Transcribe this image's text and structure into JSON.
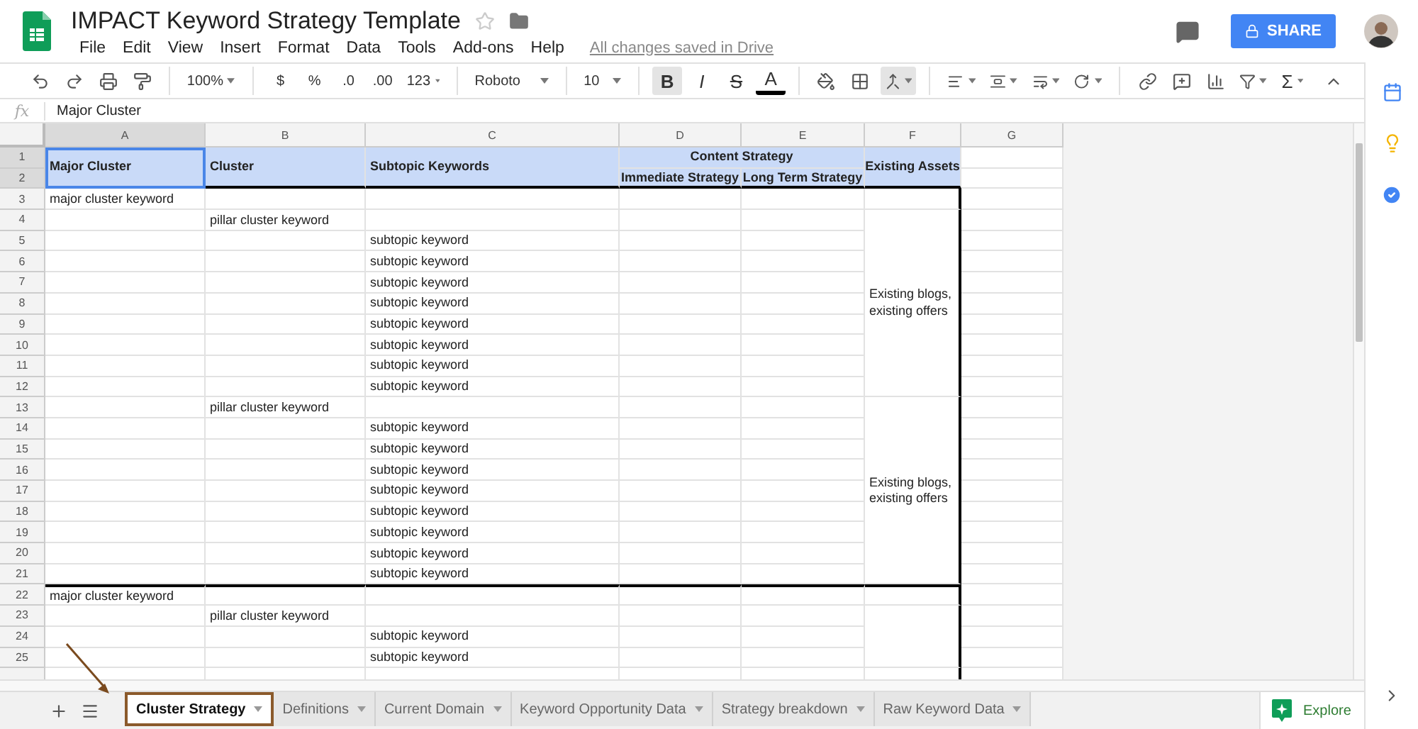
{
  "document": {
    "title": "IMPACT Keyword Strategy Template",
    "save_status": "All changes saved in Drive"
  },
  "menu": [
    "File",
    "Edit",
    "View",
    "Insert",
    "Format",
    "Data",
    "Tools",
    "Add-ons",
    "Help"
  ],
  "share": {
    "label": "SHARE"
  },
  "toolbar": {
    "zoom": "100%",
    "currency": "$",
    "percent": "%",
    "decrease_decimals": ".0",
    "increase_decimals": ".00",
    "number_format": "123",
    "font": "Roboto",
    "font_size": "10",
    "sum": "Σ",
    "styles": [
      {
        "label": "B",
        "kind": "bold",
        "selected": true
      },
      {
        "label": "I",
        "kind": "italic",
        "selected": false
      },
      {
        "label": "S",
        "kind": "strike",
        "selected": false
      },
      {
        "label": "A",
        "kind": "color",
        "selected": false
      }
    ],
    "merge": {
      "selected": true
    }
  },
  "formula_bar": {
    "fx": "fx",
    "value": "Major Cluster"
  },
  "sheet": {
    "columns": [
      {
        "label": "A",
        "selected": true
      },
      {
        "label": "B",
        "selected": false
      },
      {
        "label": "C",
        "selected": false
      },
      {
        "label": "D",
        "selected": false
      },
      {
        "label": "E",
        "selected": false
      },
      {
        "label": "F",
        "selected": false
      },
      {
        "label": "G",
        "selected": false
      }
    ],
    "row_numbers": [
      {
        "label": "1",
        "selected": true
      },
      {
        "label": "2",
        "selected": true
      },
      {
        "label": "3",
        "selected": false
      },
      {
        "label": "4",
        "selected": false
      },
      {
        "label": "5",
        "selected": false
      },
      {
        "label": "6",
        "selected": false
      },
      {
        "label": "7",
        "selected": false
      },
      {
        "label": "8",
        "selected": false
      },
      {
        "label": "9",
        "selected": false
      },
      {
        "label": "10",
        "selected": false
      },
      {
        "label": "11",
        "selected": false
      },
      {
        "label": "12",
        "selected": false
      },
      {
        "label": "13",
        "selected": false
      },
      {
        "label": "14",
        "selected": false
      },
      {
        "label": "15",
        "selected": false
      },
      {
        "label": "16",
        "selected": false
      },
      {
        "label": "17",
        "selected": false
      },
      {
        "label": "18",
        "selected": false
      },
      {
        "label": "19",
        "selected": false
      },
      {
        "label": "20",
        "selected": false
      },
      {
        "label": "21",
        "selected": false
      },
      {
        "label": "22",
        "selected": false
      },
      {
        "label": "23",
        "selected": false
      },
      {
        "label": "24",
        "selected": false
      },
      {
        "label": "25",
        "selected": false
      }
    ],
    "header": {
      "major": "Major Cluster",
      "cluster": "Cluster",
      "subtopic": "Subtopic Keywords",
      "content_strategy": "Content Strategy",
      "immediate": "Immediate Strategy",
      "long_term": "Long Term Strategy",
      "assets": "Existing Assets"
    },
    "groups": [
      {
        "major": "major cluster keyword",
        "pillars": [
          {
            "keyword": "pillar cluster keyword",
            "assets": "Existing blogs, existing offers",
            "subtopics": [
              "subtopic keyword",
              "subtopic keyword",
              "subtopic keyword",
              "subtopic keyword",
              "subtopic keyword",
              "subtopic keyword",
              "subtopic keyword",
              "subtopic keyword"
            ]
          },
          {
            "keyword": "pillar cluster keyword",
            "assets": "Existing blogs, existing offers",
            "subtopics": [
              "subtopic keyword",
              "subtopic keyword",
              "subtopic keyword",
              "subtopic keyword",
              "subtopic keyword",
              "subtopic keyword",
              "subtopic keyword",
              "subtopic keyword"
            ]
          }
        ]
      },
      {
        "major": "major cluster keyword",
        "pillars": [
          {
            "keyword": "pillar cluster keyword",
            "subtopics": [
              "subtopic keyword",
              "subtopic keyword"
            ]
          }
        ]
      }
    ]
  },
  "sheet_tabs": [
    {
      "label": "Cluster Strategy",
      "selected": true
    },
    {
      "label": "Definitions",
      "selected": false
    },
    {
      "label": "Current Domain",
      "selected": false
    },
    {
      "label": "Keyword Opportunity Data",
      "selected": false
    },
    {
      "label": "Strategy breakdown",
      "selected": false
    },
    {
      "label": "Raw Keyword Data",
      "selected": false
    }
  ],
  "explore": {
    "label": "Explore"
  }
}
